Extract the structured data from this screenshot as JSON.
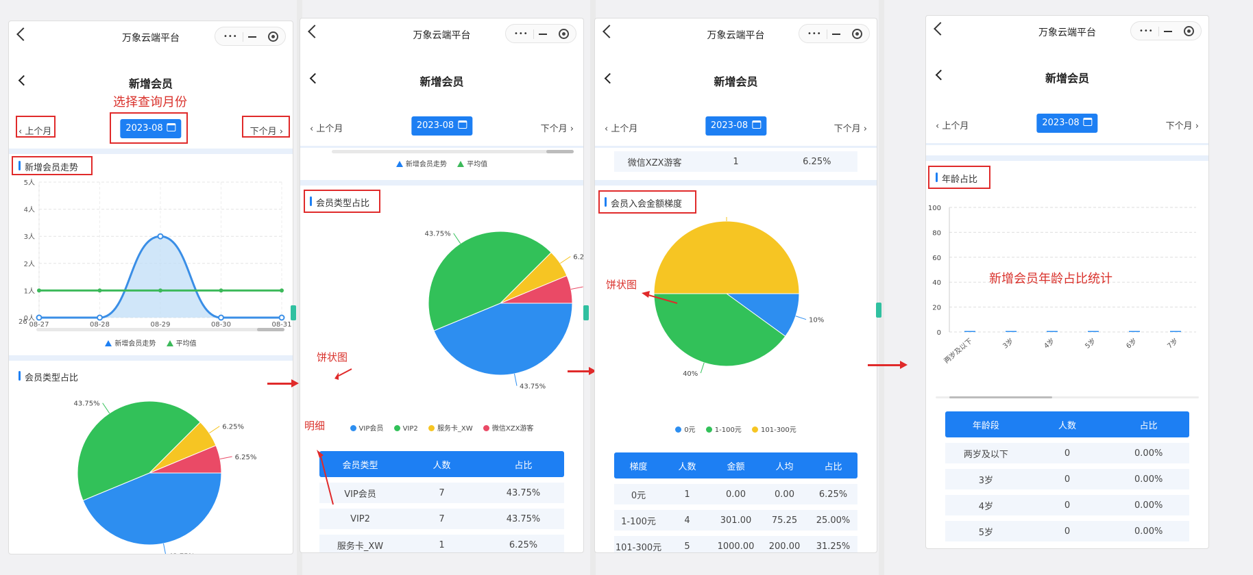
{
  "app_title": "万象云端平台",
  "page_title": "新增会员",
  "prev_month": "上个月",
  "next_month": "下个月",
  "date": "2023-08",
  "annotations": {
    "select_month": "选择查询月份",
    "pie1": "饼状图",
    "detail": "明细",
    "pie2": "饼状图",
    "age_stat": "新增会员年龄占比统计"
  },
  "panel1": {
    "trend_title": "新增会员走势",
    "type_title": "会员类型占比",
    "y_ticks": [
      "5人",
      "4人",
      "3人",
      "2人",
      "1人",
      "0人"
    ],
    "x_ticks": [
      "08-27",
      "08-28",
      "08-29",
      "08-30",
      "08-31"
    ],
    "x_left_label": "26",
    "legend": [
      "新增会员走势",
      "平均值"
    ]
  },
  "panel2": {
    "legend_top": [
      "新增会员走势",
      "平均值"
    ],
    "section_title": "会员类型占比",
    "legend": [
      "VIP会员",
      "VIP2",
      "服务卡_XW",
      "微信XZX游客"
    ],
    "table_headers": [
      "会员类型",
      "人数",
      "占比"
    ],
    "rows": [
      [
        "VIP会员",
        "7",
        "43.75%"
      ],
      [
        "VIP2",
        "7",
        "43.75%"
      ],
      [
        "服务卡_XW",
        "1",
        "6.25%"
      ]
    ]
  },
  "panel3": {
    "top_row": [
      "微信XZX游客",
      "1",
      "6.25%"
    ],
    "section_title": "会员入会金额梯度",
    "legend": [
      "0元",
      "1-100元",
      "101-300元"
    ],
    "table_headers": [
      "梯度",
      "人数",
      "金额",
      "人均",
      "占比"
    ],
    "rows": [
      [
        "0元",
        "1",
        "0.00",
        "0.00",
        "6.25%"
      ],
      [
        "1-100元",
        "4",
        "301.00",
        "75.25",
        "25.00%"
      ],
      [
        "101-300元",
        "5",
        "1000.00",
        "200.00",
        "31.25%"
      ]
    ]
  },
  "panel4": {
    "section_title": "年龄占比",
    "y_ticks": [
      "100",
      "80",
      "60",
      "40",
      "20",
      "0"
    ],
    "x_ticks": [
      "两岁及以下",
      "3岁",
      "4岁",
      "5岁",
      "6岁",
      "7岁"
    ],
    "table_headers": [
      "年龄段",
      "人数",
      "占比"
    ],
    "rows": [
      [
        "两岁及以下",
        "0",
        "0.00%"
      ],
      [
        "3岁",
        "0",
        "0.00%"
      ],
      [
        "4岁",
        "0",
        "0.00%"
      ],
      [
        "5岁",
        "0",
        "0.00%"
      ]
    ]
  },
  "chart_data": [
    {
      "type": "line",
      "title": "新增会员走势",
      "x": [
        "08-27",
        "08-28",
        "08-29",
        "08-30",
        "08-31"
      ],
      "series": [
        {
          "name": "新增会员走势",
          "values": [
            0,
            0,
            3,
            0,
            0
          ],
          "color": "#3a8ee6"
        },
        {
          "name": "平均值",
          "values": [
            1,
            1,
            1,
            1,
            1
          ],
          "color": "#3cb95a"
        }
      ],
      "ylim": [
        0,
        5
      ],
      "legend": "bottom"
    },
    {
      "type": "pie",
      "title": "会员类型占比",
      "slices": [
        {
          "name": "VIP会员",
          "value": 43.75,
          "color": "#2d8ef0"
        },
        {
          "name": "VIP2",
          "value": 43.75,
          "color": "#32c159"
        },
        {
          "name": "服务卡_XW",
          "value": 6.25,
          "color": "#f6c523"
        },
        {
          "name": "微信XZX游客",
          "value": 6.25,
          "color": "#ea4a66"
        }
      ],
      "legend": "bottom"
    },
    {
      "type": "pie",
      "title": "会员入会金额梯度",
      "slices": [
        {
          "name": "0元",
          "value": 10,
          "color": "#2d8ef0"
        },
        {
          "name": "1-100元",
          "value": 40,
          "color": "#32c159"
        },
        {
          "name": "101-300元",
          "value": 50,
          "color": "#f6c523"
        }
      ],
      "legend": "bottom"
    },
    {
      "type": "bar",
      "title": "年龄占比",
      "categories": [
        "两岁及以下",
        "3岁",
        "4岁",
        "5岁",
        "6岁",
        "7岁"
      ],
      "values": [
        0,
        0,
        0,
        0,
        0,
        0
      ],
      "ylim": [
        0,
        100
      ]
    }
  ]
}
